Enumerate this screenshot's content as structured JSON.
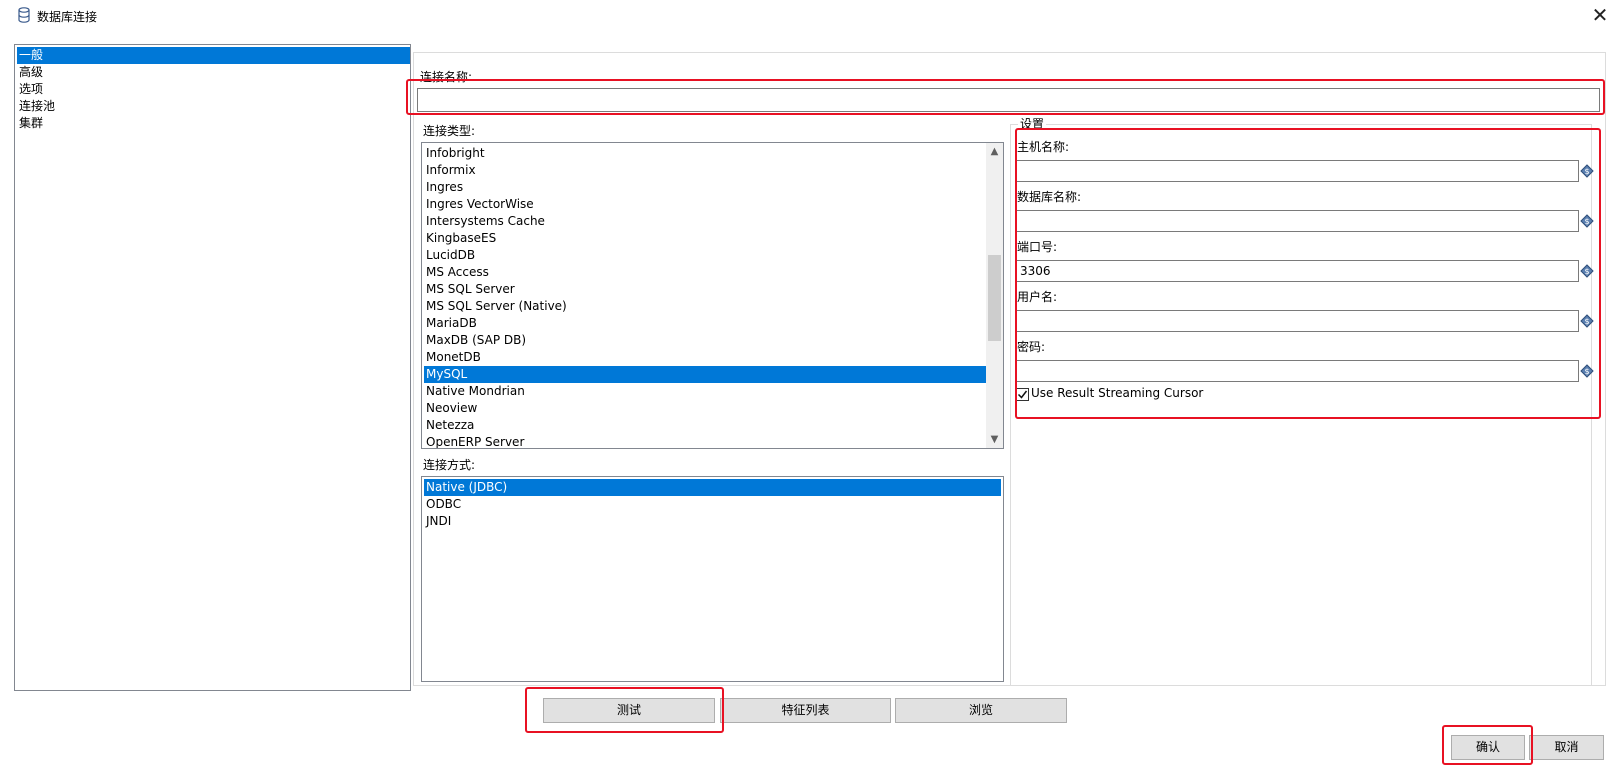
{
  "window": {
    "title": "数据库连接",
    "close_glyph": "✕"
  },
  "nav": {
    "items": [
      {
        "label": "一般",
        "selected": true
      },
      {
        "label": "高级",
        "selected": false
      },
      {
        "label": "选项",
        "selected": false
      },
      {
        "label": "连接池",
        "selected": false
      },
      {
        "label": "集群",
        "selected": false
      }
    ]
  },
  "connection_name": {
    "label": "连接名称:",
    "value": ""
  },
  "connection_type": {
    "label": "连接类型:",
    "items": [
      "Infobright",
      "Informix",
      "Ingres",
      "Ingres VectorWise",
      "Intersystems Cache",
      "KingbaseES",
      "LucidDB",
      "MS Access",
      "MS SQL Server",
      "MS SQL Server (Native)",
      "MariaDB",
      "MaxDB (SAP DB)",
      "MonetDB",
      "MySQL",
      "Native Mondrian",
      "Neoview",
      "Netezza",
      "OpenERP Server"
    ],
    "selected": "MySQL"
  },
  "access_method": {
    "label": "连接方式:",
    "items": [
      "Native (JDBC)",
      "ODBC",
      "JNDI"
    ],
    "selected": "Native (JDBC)"
  },
  "settings": {
    "title": "设置",
    "host": {
      "label": "主机名称:",
      "value": ""
    },
    "database": {
      "label": "数据库名称:",
      "value": ""
    },
    "port": {
      "label": "端口号:",
      "value": "3306"
    },
    "username": {
      "label": "用户名:",
      "value": ""
    },
    "password": {
      "label": "密码:",
      "value": ""
    },
    "streaming_cursor": {
      "label": "Use Result Streaming Cursor",
      "checked": true
    }
  },
  "buttons": {
    "test": "测试",
    "features": "特征列表",
    "explore": "浏览",
    "ok": "确认",
    "cancel": "取消"
  },
  "colors": {
    "selection": "#0078d7",
    "highlight_box": "#e81123"
  }
}
